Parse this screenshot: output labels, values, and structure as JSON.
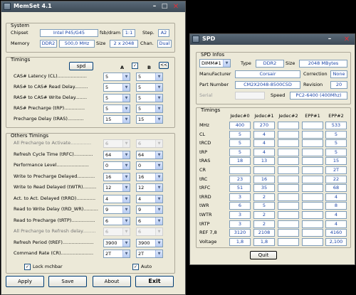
{
  "memset": {
    "title": "MemSet 4.1",
    "system": {
      "group_label": "System",
      "chipset_label": "Chipset",
      "chipset_value": "Intel P45/G45",
      "fsb_label": "fsb/dram",
      "fsb_value": "1:1",
      "step_label": "Step.",
      "step_value": "A2",
      "memory_label": "Memory",
      "memory_type": "DDR2",
      "memory_freq": "500,0 MHz",
      "size_label": "Size",
      "size_value": "2 x 2048",
      "chan_label": "Chan.",
      "chan_value": "Dual"
    },
    "timings": {
      "group_label": "Timings",
      "spd_button": "spd",
      "col_a": "A",
      "col_b": "B",
      "copy_button": "<<",
      "rows": [
        {
          "label": "CAS# Latency (CL)....................",
          "a": "5",
          "b": "5"
        },
        {
          "label": "RAS# to CAS# Read Delay.........",
          "a": "5",
          "b": "5"
        },
        {
          "label": "RAS# to CAS# Write Delay........",
          "a": "5",
          "b": "5"
        },
        {
          "label": "RAS# Precharge (tRP)..............",
          "a": "5",
          "b": "5"
        },
        {
          "label": "Precharge Delay  (tRAS)...........",
          "a": "15",
          "b": "15"
        }
      ]
    },
    "others": {
      "group_label": "Others Timings",
      "rows": [
        {
          "label": "All Precharge to Activate..............",
          "a": "6",
          "b": "6",
          "disabled": true
        },
        {
          "label": "Refresh Cycle Time (tRFC).............",
          "a": "64",
          "b": "64",
          "disabled": false
        },
        {
          "label": "Performance Level......................",
          "a": "0",
          "b": "0",
          "disabled": false
        },
        {
          "label": "Write to Precharge Delayed............",
          "a": "16",
          "b": "16",
          "disabled": false
        },
        {
          "label": "Write to Read Delayed (tWTR).........",
          "a": "12",
          "b": "12",
          "disabled": false
        },
        {
          "label": "Act. to Act. Delayed (tRRD).............",
          "a": "4",
          "b": "4",
          "disabled": false
        },
        {
          "label": "Read to Write Delay (tRD_WR)..........",
          "a": "9",
          "b": "9",
          "disabled": false
        },
        {
          "label": "Read to Precharge (tRTP)................",
          "a": "6",
          "b": "6",
          "disabled": false
        },
        {
          "label": "All Precharge to Refresh delay.........",
          "a": "6",
          "b": "6",
          "disabled": true
        },
        {
          "label": "Refresh Period (tREF).....................",
          "a": "3900",
          "b": "3900",
          "disabled": false
        },
        {
          "label": "Command Rate (CR)......................",
          "a": "2T",
          "b": "2T",
          "disabled": false
        }
      ],
      "lock_label": "Lock mchbar",
      "auto_label": "Auto"
    },
    "buttons": {
      "apply": "Apply",
      "save": "Save",
      "about": "About",
      "exit": "Exit"
    }
  },
  "spd": {
    "title": "SPD",
    "infos": {
      "group_label": "SPD Infos",
      "dimm_select": "DIMM#1",
      "type_label": "Type",
      "type_value": "DDR2",
      "size_label": "Size",
      "size_value": "2048 MBytes",
      "manufacturer_label": "ManuFacturer",
      "manufacturer_value": "Corsair",
      "correction_label": "Correction",
      "correction_value": "None",
      "part_label": "Part Number",
      "part_value": "CM2X2048-8500C5D",
      "revision_label": "Revision",
      "revision_value": "20",
      "serial_label": "Serial",
      "serial_value": "",
      "speed_label": "Speed",
      "speed_value": "PC2-6400 (400Mhz)"
    },
    "timings": {
      "group_label": "Timings",
      "headers": [
        "Jedec#0",
        "Jedec#1",
        "Jedec#2",
        "EPP#1",
        "EPP#2"
      ],
      "rows": [
        {
          "label": "MHz",
          "values": [
            "400",
            "270",
            "",
            "",
            "533"
          ]
        },
        {
          "label": "CL",
          "values": [
            "5",
            "4",
            "",
            "",
            "5"
          ]
        },
        {
          "label": "tRCD",
          "values": [
            "5",
            "4",
            "",
            "",
            "5"
          ]
        },
        {
          "label": "tRP",
          "values": [
            "5",
            "4",
            "",
            "",
            "5"
          ]
        },
        {
          "label": "tRAS",
          "values": [
            "18",
            "13",
            "",
            "",
            "15"
          ]
        },
        {
          "label": "CR",
          "values": [
            "",
            "",
            "",
            "",
            "2T"
          ]
        },
        {
          "label": "tRC",
          "values": [
            "23",
            "16",
            "",
            "",
            "22"
          ]
        },
        {
          "label": "tRFC",
          "values": [
            "51",
            "35",
            "",
            "",
            "68"
          ]
        },
        {
          "label": "tRRD",
          "values": [
            "3",
            "2",
            "",
            "",
            "4"
          ]
        },
        {
          "label": "tWR",
          "values": [
            "6",
            "5",
            "",
            "",
            "8"
          ]
        },
        {
          "label": "tWTR",
          "values": [
            "3",
            "2",
            "",
            "",
            "4"
          ]
        },
        {
          "label": "tRTP",
          "values": [
            "3",
            "2",
            "",
            "",
            "4"
          ]
        },
        {
          "label": "REF 7,8",
          "values": [
            "3120",
            "2108",
            "",
            "",
            "4160"
          ]
        },
        {
          "label": "Voltage",
          "values": [
            "1,8",
            "1,8",
            "",
            "",
            "2,100"
          ]
        }
      ]
    },
    "quit_button": "Quit"
  }
}
